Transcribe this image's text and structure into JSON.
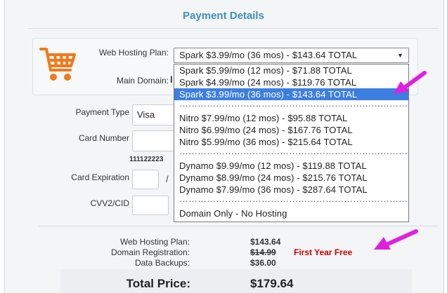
{
  "header": {
    "title": "Payment Details"
  },
  "plan": {
    "label": "Web Hosting Plan:",
    "selected": "Spark $3.99/mo (36 mos) - $143.64 TOTAL",
    "domain_label": "Main Domain:",
    "domain_value": "l",
    "options": [
      {
        "label": "Spark $5.99/mo (12 mos) - $71.88 TOTAL"
      },
      {
        "label": "Spark $4.99/mo (24 mos) - $119.76 TOTAL"
      },
      {
        "label": "Spark $3.99/mo (36 mos) - $143.64 TOTAL",
        "selected": true
      },
      {
        "separator": true,
        "label": "………………………………………………………………………………"
      },
      {
        "label": "Nitro $7.99/mo (12 mos) - $95.88 TOTAL"
      },
      {
        "label": "Nitro $6.99/mo (24 mos) - $167.76 TOTAL"
      },
      {
        "label": "Nitro $5.99/mo (36 mos) - $215.64 TOTAL"
      },
      {
        "separator": true,
        "label": "………………………………………………………………………………"
      },
      {
        "label": "Dynamo $9.99/mo (12 mos) - $119.88 TOTAL"
      },
      {
        "label": "Dynamo $8.99/mo (24 mos) - $215.76 TOTAL"
      },
      {
        "label": "Dynamo $7.99/mo (36 mos) - $287.64 TOTAL"
      },
      {
        "separator": true,
        "label": "………………………………………………………………………………"
      },
      {
        "label": "Domain Only - No Hosting"
      }
    ]
  },
  "payment": {
    "type_label": "Payment Type",
    "type_value": "Visa",
    "card_label": "Card Number",
    "card_hint": "111122223",
    "exp_label": "Card Expiration",
    "exp_sep": "/",
    "cvv_label": "CVV2/CID"
  },
  "summary": {
    "hosting_label": "Web Hosting Plan:",
    "hosting_value": "$143.64",
    "domain_label": "Domain Registration:",
    "domain_value": "$14.99",
    "domain_note": "First Year Free",
    "backup_label": "Data Backups:",
    "backup_value": "$36.00",
    "total_label": "Total Price:",
    "total_value": "$179.64"
  },
  "colors": {
    "accent": "#3a8fc1",
    "selected": "#3d7fe0",
    "arrow": "#e020e0",
    "note": "#cc0000",
    "cart": "#f07a1a"
  },
  "icons": {
    "cart": "shopping-cart-icon",
    "arrow": "pointer-arrow-icon"
  }
}
